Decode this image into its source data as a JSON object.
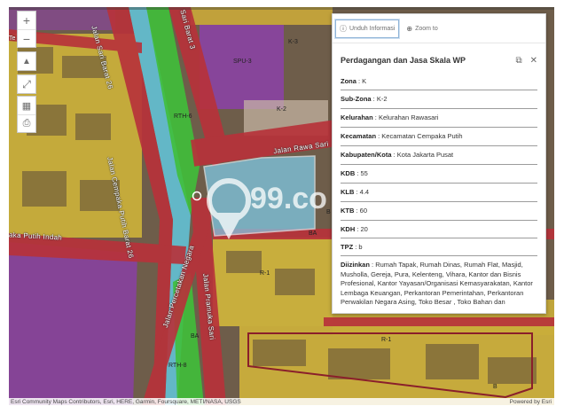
{
  "map_labels": {
    "k3": "K-3",
    "spu3": "SPU-3",
    "k2": "K-2",
    "rth6": "RTH-6",
    "r1_main": "R-1",
    "r1_small": "R-1",
    "ba_mid": "BA",
    "ba_low": "BA",
    "rth8": "RTH-8",
    "b_left": "B",
    "b_right": "B"
  },
  "road_labels": {
    "sari_barat26": "Jalan Sari Barat 26",
    "sari_barat3": "Sari Barat 3",
    "rawa_sari": "Jalan Rawa Sari",
    "cempaka_putih_barat26": "Jalan Cempaka Putih Barat 26",
    "percetakan_negara": "Jalan Percetakan Negara",
    "pramuka_sari": "Jalan Pramuka Sari",
    "cempaka_putih_indah": "aka Putih Indah",
    "jl26_edge": "Te 26"
  },
  "controls": {
    "zoom_in": "+",
    "zoom_out": "−",
    "compass": "▲",
    "fullscreen": "⤢",
    "qr": "▦",
    "print": "⎙"
  },
  "popup": {
    "actions": {
      "download": "Unduh Informasi",
      "zoom": "Zoom to"
    },
    "title": "Perdagangan dan Jasa Skala WP",
    "fields": [
      {
        "key": "Zona",
        "value": " : K"
      },
      {
        "key": "Sub-Zona",
        "value": " : K-2"
      },
      {
        "key": "Kelurahan",
        "value": " : Kelurahan Rawasari"
      },
      {
        "key": "Kecamatan",
        "value": " : Kecamatan Cempaka Putih"
      },
      {
        "key": "Kabupaten/Kota",
        "value": " : Kota Jakarta Pusat"
      },
      {
        "key": "KDB",
        "value": " : 55"
      },
      {
        "key": "KLB",
        "value": " : 4.4"
      },
      {
        "key": "KTB",
        "value": " : 60"
      },
      {
        "key": "KDH",
        "value": " : 20"
      },
      {
        "key": "TPZ",
        "value": " : b"
      }
    ],
    "allowed": {
      "key": "Diizinkan",
      "value": " : Rumah Tapak, Rumah Dinas, Rumah Flat, Masjid, Musholla, Gereja, Pura, Kelenteng, Vihara, Kantor dan Bisnis Profesional, Kantor Yayasan/Organisasi Kemasyarakatan, Kantor Lembaga Keuangan, Perkantoran Pemerintahan, Perkantoran Perwakilan Negara Asing, Toko Besar , Toko Bahan dan Perlengkapan Bangunan, Bangunan Jasa Penerbitan, Pertokoan, Minimarket,"
    }
  },
  "watermark": "99.co",
  "attribution": {
    "left": "Esri Community Maps Contributors, Esri, HERE, Garmin, Foursquare, METI/NASA, USGS",
    "right": "Powered by Esri"
  },
  "colors": {
    "residential": "#d4b83a",
    "commercial": "#8d3fa6",
    "green": "#3fbf3a",
    "road": "#b9343a",
    "selected": "#7fd0ee",
    "water": "#63b7c7"
  }
}
